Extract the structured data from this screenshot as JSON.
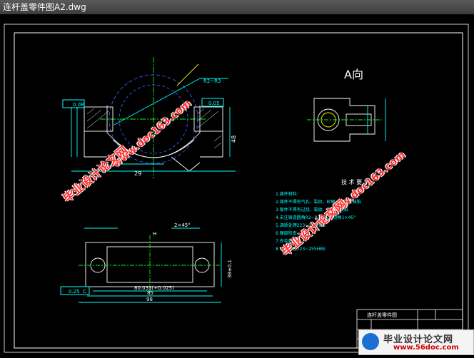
{
  "window": {
    "title": "连杆盖零件图A2.dwg"
  },
  "drawing": {
    "view_a_label": "A向",
    "tech_req_title": "技 术 要 求",
    "tech_req_items": [
      "1.铸件材料：",
      "2.铸件不得有气孔、裂纹、砂眼、缩松等缺陷",
      "3.锻件不得有过烧、裂纹、折叠等缺陷",
      "4.未注铸造圆角R2~R3，未注倒角1×45°",
      "5.调质处理223~250HBS",
      "6.硬度检查",
      "7.去毛刺锐边",
      "8.调质处理223~255HBS"
    ],
    "dims": {
      "bottom_width_1": "80.033(+0.025)",
      "bottom_width_2": "85",
      "bottom_width_3": "98",
      "left_tol_box": "0.25",
      "left_tol_ref": "C",
      "top_tol_box": "0.08",
      "top_tol_box_2": "0.05",
      "dim_29": "29",
      "dim_48": "48",
      "dim_r": "R2~R3",
      "dim_45": "2×45°",
      "dim_38": "38±0.1",
      "dim_h": "H"
    },
    "title_block": {
      "part_name": "连杆盖零件图"
    }
  },
  "watermarks": {
    "text_cn": "毕业设计论文网",
    "text_url": "www.doc163.com"
  },
  "logo": {
    "title": "毕业设计论文网",
    "url": "www.56doc.com"
  },
  "colors": {
    "background": "#000000",
    "line_white": "#ffffff",
    "line_cyan": "#00ffff",
    "line_blue": "#3a5cff",
    "line_yellow": "#ffff00",
    "line_green": "#00ff00",
    "watermark": "#ff2a2a"
  }
}
